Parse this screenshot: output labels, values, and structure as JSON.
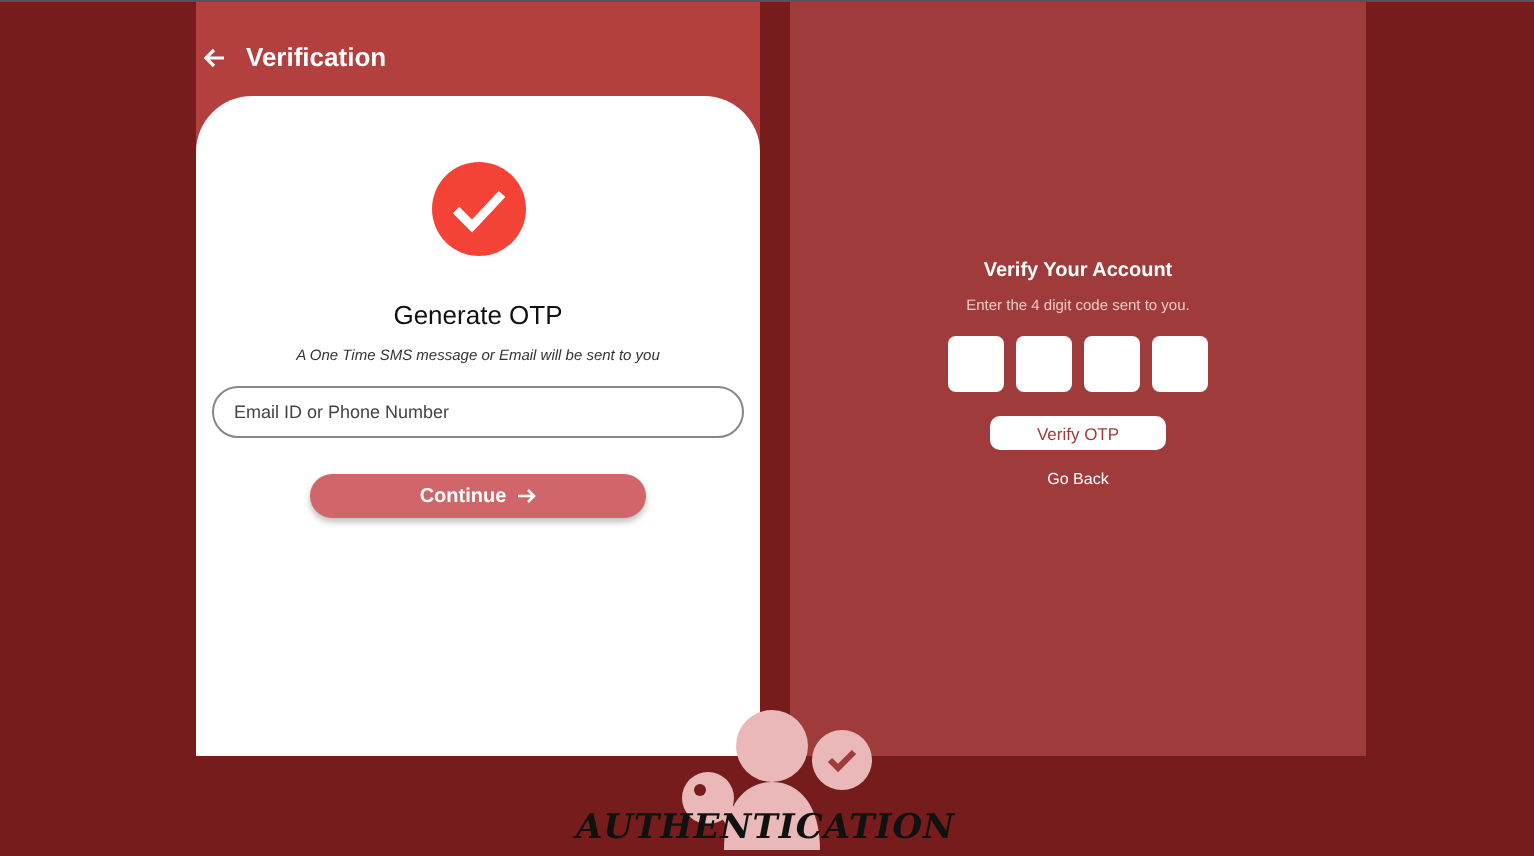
{
  "app_bar": {
    "title": "Verification"
  },
  "generate": {
    "heading": "Generate OTP",
    "subtitle": "A One Time SMS message or Email will be sent to you",
    "input": {
      "placeholder": "Email ID or Phone Number"
    },
    "button": "Continue"
  },
  "verify": {
    "title": "Verify Your Account",
    "subtitle": "Enter the 4 digit code sent to you.",
    "button": "Verify OTP",
    "link": "Go Back"
  },
  "logo": {
    "text": "AUTHENTICATION"
  }
}
